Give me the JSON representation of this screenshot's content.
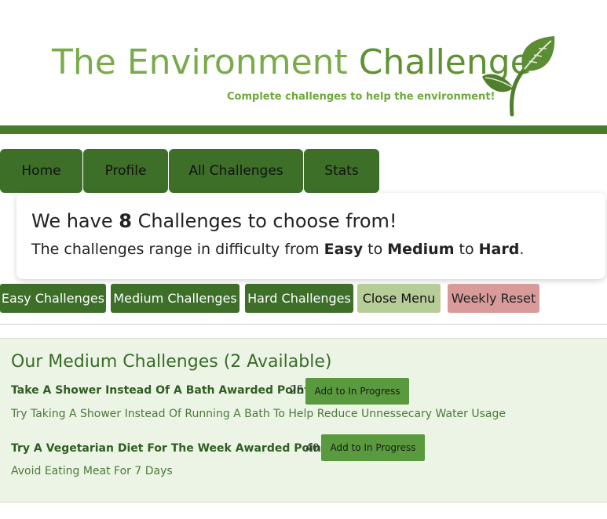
{
  "header": {
    "title_part1": "The Environment ",
    "title_part2": "Challenge",
    "tagline": "Complete challenges to help the environment!",
    "logo_icon": "leaf-icon",
    "colors": {
      "title_light": "#7aab4b",
      "title_dark": "#5e9333",
      "bar": "#4a7a2c"
    }
  },
  "nav": {
    "items": [
      {
        "label": "Home"
      },
      {
        "label": "Profile"
      },
      {
        "label": "All Challenges"
      },
      {
        "label": "Stats"
      }
    ]
  },
  "info": {
    "h1_pre": "We have ",
    "h1_count": "8",
    "h1_post": " Challenges to choose from!",
    "h2_pre": "The challenges range in difficulty from ",
    "h2_easy": "Easy",
    "h2_to1": " to ",
    "h2_medium": "Medium",
    "h2_to2": " to ",
    "h2_hard": "Hard",
    "h2_end": "."
  },
  "filters": {
    "easy": "Easy Challenges",
    "medium": "Medium Challenges",
    "hard": "Hard Challenges",
    "close": "Close Menu",
    "reset": "Weekly Reset"
  },
  "panel": {
    "title": "Our Medium Challenges (2 Available)",
    "challenges": [
      {
        "title": "Take A Shower Instead Of A Bath Awarded Points:",
        "points": "25",
        "button": "Add to In Progress",
        "description": "Try Taking A Shower Instead Of Running A Bath To Help Reduce Unnessecary Water Usage"
      },
      {
        "title": "Try A Vegetarian Diet For The Week Awarded Points:",
        "points": "40",
        "button": "Add to In Progress",
        "description": "Avoid Eating Meat For 7 Days"
      }
    ]
  }
}
